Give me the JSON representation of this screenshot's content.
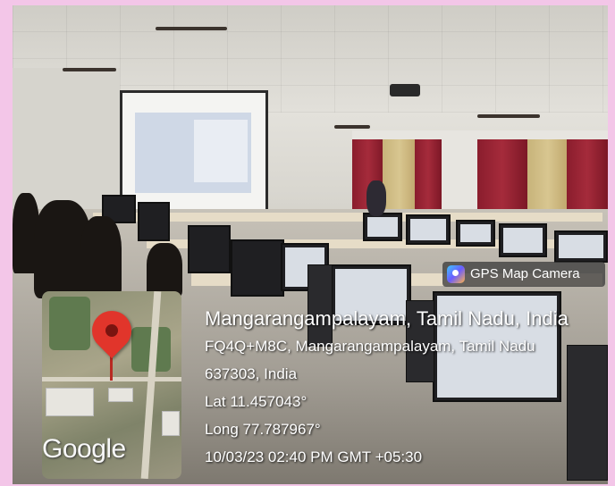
{
  "photo": {
    "subject": "computer lab"
  },
  "watermark": {
    "app_label": "GPS Map Camera",
    "app_icon": "gps-map-camera-icon",
    "place": "Mangarangampalayam, Tamil Nadu, India",
    "address_line1": "FQ4Q+M8C, Mangarangampalayam, Tamil Nadu",
    "address_line2": "637303, India",
    "latitude": "Lat 11.457043°",
    "longitude": "Long 77.787967°",
    "datetime": "10/03/23 02:40 PM GMT +05:30",
    "map_provider": "Google",
    "pin_color": "#e1352b"
  }
}
